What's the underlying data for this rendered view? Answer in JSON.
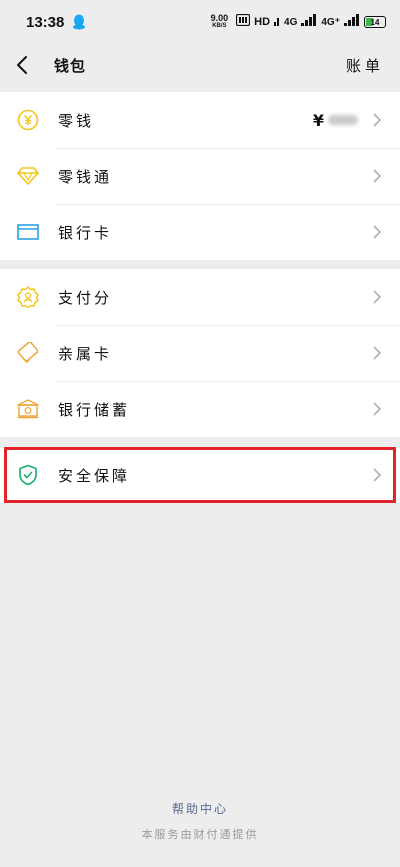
{
  "status_bar": {
    "time": "13:38",
    "net_speed_value": "9.00",
    "net_speed_unit": "KB/S",
    "hd_label": "HD",
    "signal_1": "4G",
    "signal_2": "4G⁺",
    "battery_level": "14",
    "icons": [
      "qq-icon",
      "nfc-icon",
      "signal-icon",
      "battery-icon"
    ]
  },
  "nav": {
    "title": "钱包",
    "bills_label": "账单",
    "back_icon": "chevron-left-icon"
  },
  "groups": [
    {
      "items": [
        {
          "label": "零钱",
          "icon": "yuan-coin-icon",
          "value_prefix": "¥",
          "value_hidden": true
        },
        {
          "label": "零钱通",
          "icon": "diamond-icon"
        },
        {
          "label": "银行卡",
          "icon": "card-icon"
        }
      ]
    },
    {
      "items": [
        {
          "label": "支付分",
          "icon": "badge-icon"
        },
        {
          "label": "亲属卡",
          "icon": "family-card-icon"
        },
        {
          "label": "银行储蓄",
          "icon": "bank-deposit-icon"
        }
      ]
    },
    {
      "items": [
        {
          "label": "安全保障",
          "icon": "shield-check-icon"
        }
      ]
    }
  ],
  "footer": {
    "help_link": "帮助中心",
    "service_note": "本服务由财付通提供"
  },
  "colors": {
    "background": "#ededed",
    "yellow_icon": "#f5c518",
    "blue_icon": "#2aa3e6",
    "orange_icon": "#f0a53c",
    "green_icon": "#17b06b",
    "highlight": "#e0242a",
    "link": "#576b95"
  }
}
